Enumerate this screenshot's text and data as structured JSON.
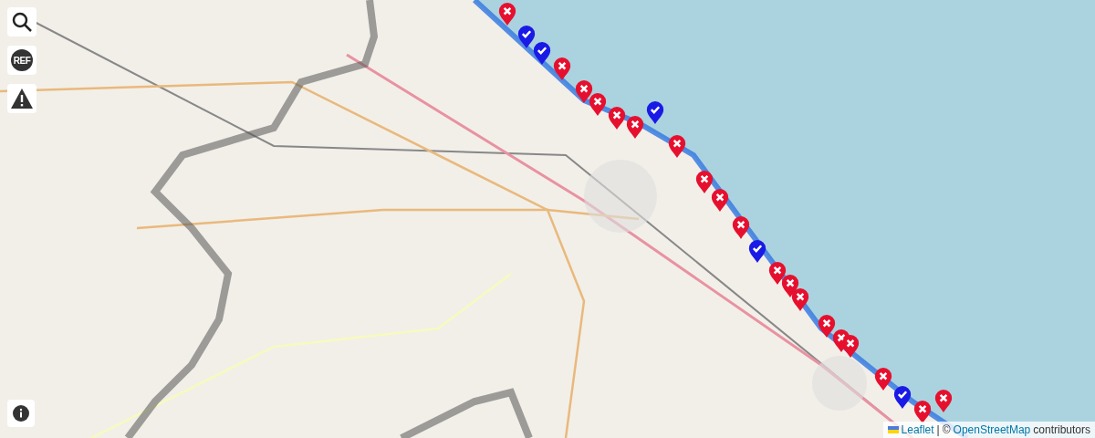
{
  "controls": [
    {
      "kind": "search"
    },
    {
      "kind": "ref",
      "label": "REF"
    },
    {
      "kind": "warning"
    }
  ],
  "markers": [
    {
      "kind": "bad"
    },
    {
      "kind": "ok"
    },
    {
      "kind": "ok"
    },
    {
      "kind": "bad"
    },
    {
      "kind": "bad"
    },
    {
      "kind": "bad"
    },
    {
      "kind": "bad"
    },
    {
      "kind": "bad"
    },
    {
      "kind": "ok"
    },
    {
      "kind": "bad"
    },
    {
      "kind": "bad"
    },
    {
      "kind": "bad"
    },
    {
      "kind": "bad"
    },
    {
      "kind": "ok"
    },
    {
      "kind": "bad"
    },
    {
      "kind": "bad"
    },
    {
      "kind": "bad"
    },
    {
      "kind": "bad"
    },
    {
      "kind": "bad"
    },
    {
      "kind": "bad"
    },
    {
      "kind": "bad"
    },
    {
      "kind": "ok"
    },
    {
      "kind": "bad"
    },
    {
      "kind": "bad"
    }
  ],
  "attribution": {
    "leaflet": "Leaflet",
    "separator": "|",
    "copyright": "©",
    "osm": "OpenStreetMap",
    "suffix": "contributors"
  }
}
